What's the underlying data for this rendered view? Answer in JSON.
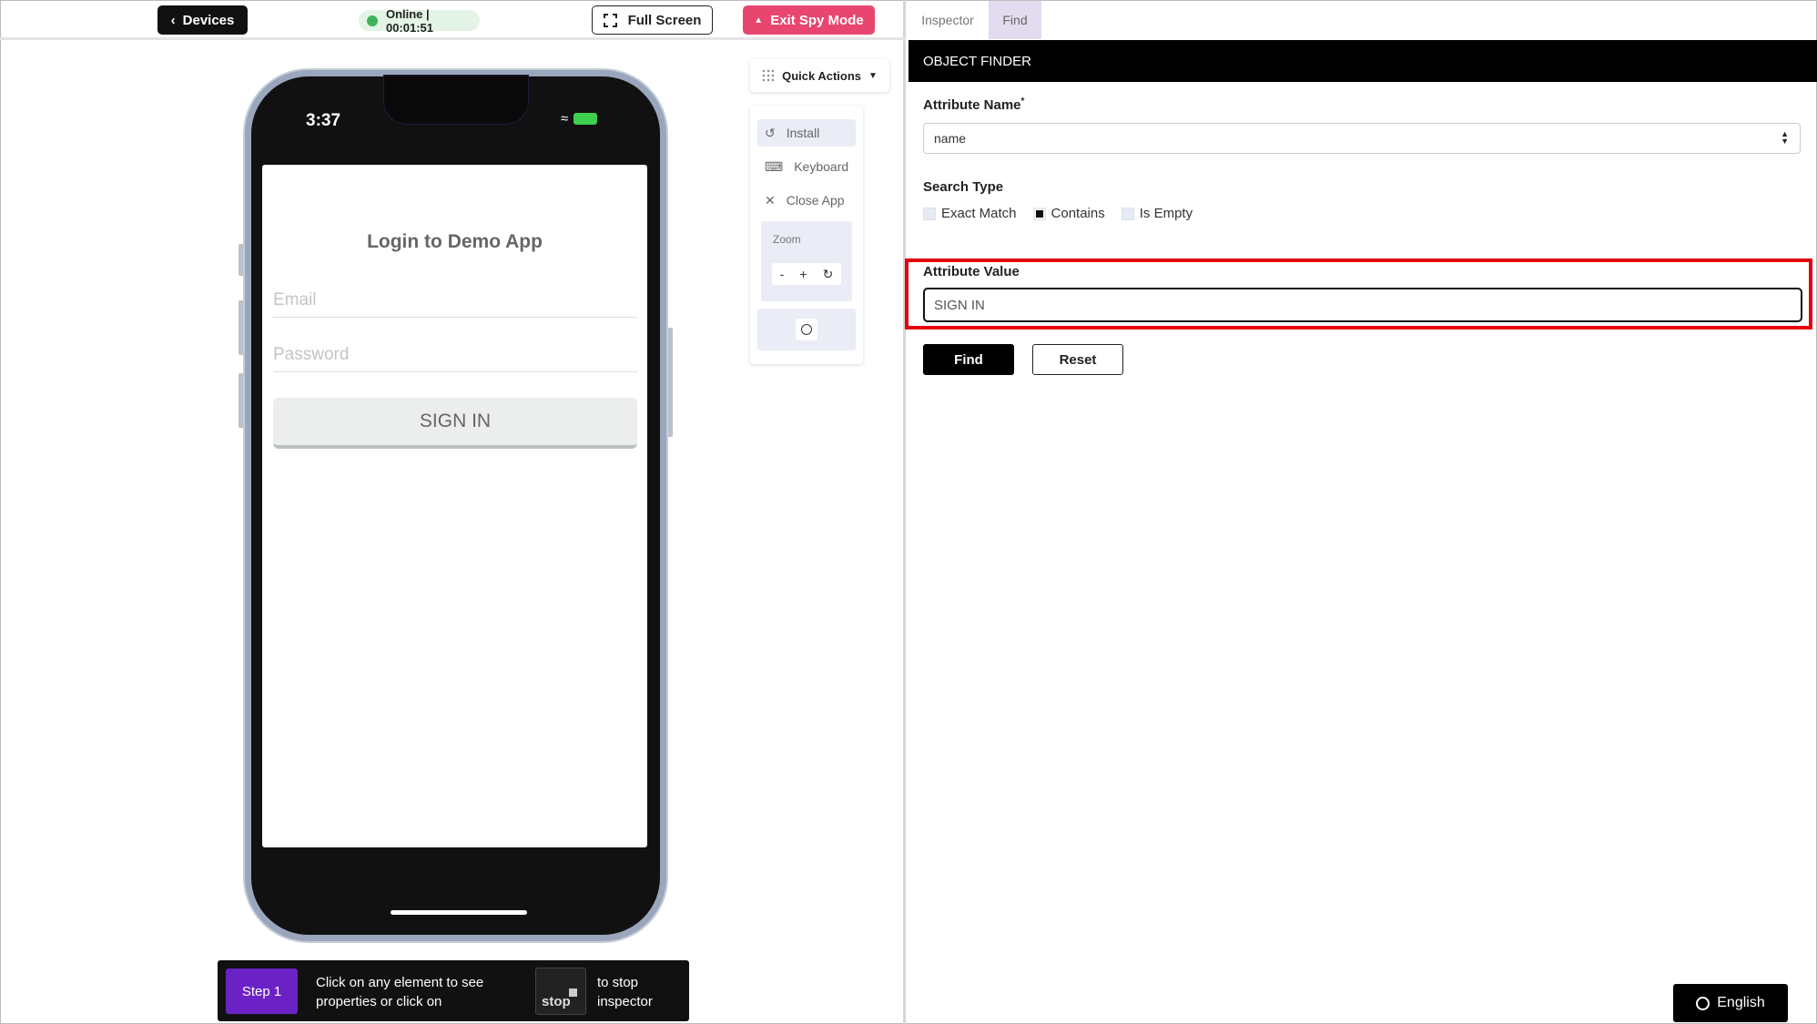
{
  "toolbar": {
    "devices_label": "Devices",
    "status_text": "Online | 00:01:51",
    "fullscreen_label": "Full Screen",
    "exit_label": "Exit Spy Mode"
  },
  "device": {
    "time": "3:37",
    "app_title": "Login to Demo App",
    "email_placeholder": "Email",
    "password_placeholder": "Password",
    "signin_label": "SIGN IN"
  },
  "quick_actions": {
    "label": "Quick Actions",
    "items": [
      {
        "label": "Install",
        "icon": "install-icon"
      },
      {
        "label": "Keyboard",
        "icon": "keyboard-icon"
      },
      {
        "label": "Close App",
        "icon": "close-icon"
      }
    ],
    "zoom_label": "Zoom",
    "zoom_minus": "-",
    "zoom_plus": "+"
  },
  "stepbar": {
    "step_label": "Step 1",
    "text1": "Click on any element to see properties or click on",
    "stop_label": "stop",
    "text2": "to stop inspector"
  },
  "panel": {
    "tabs": [
      {
        "label": "Inspector",
        "active": false
      },
      {
        "label": "Find",
        "active": true
      }
    ],
    "header": "OBJECT FINDER",
    "attribute_name_label": "Attribute Name",
    "attribute_name_required": "*",
    "attribute_name_value": "name",
    "search_type_label": "Search Type",
    "search_types": [
      {
        "label": "Exact Match",
        "checked": false
      },
      {
        "label": "Contains",
        "checked": true
      },
      {
        "label": "Is Empty",
        "checked": false
      }
    ],
    "attribute_value_label": "Attribute Value",
    "attribute_value": "SIGN IN",
    "find_label": "Find",
    "reset_label": "Reset",
    "language_label": "English"
  },
  "colors": {
    "accent_exit": "#e8456f",
    "step_badge": "#6a22c4",
    "status_online": "#3fb35a",
    "highlight": "#e3000f"
  }
}
